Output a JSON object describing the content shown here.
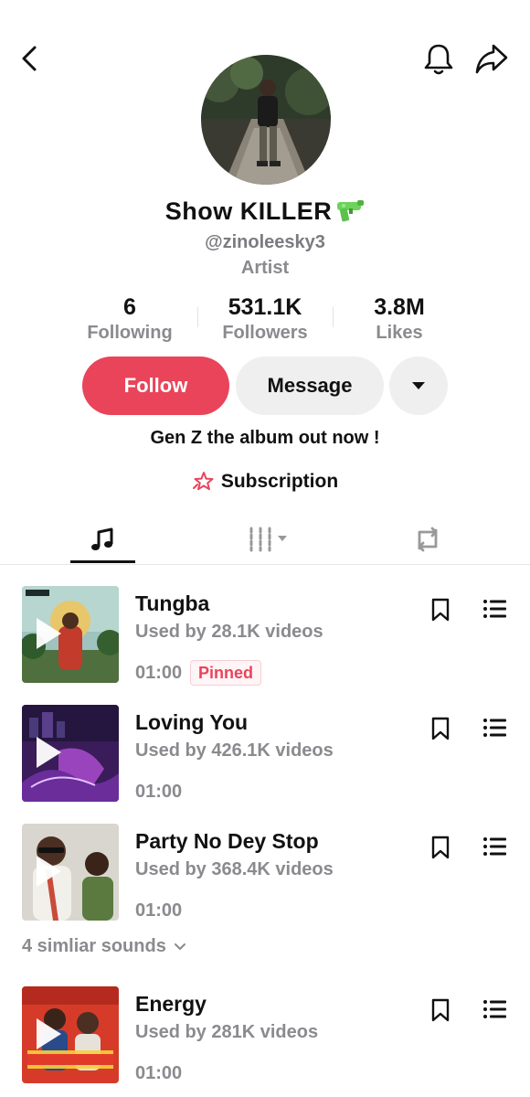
{
  "profile": {
    "name": "Show  KILLER",
    "handle": "@zinoleesky3",
    "role": "Artist",
    "bio": "Gen Z the album out now !",
    "subscription_label": "Subscription"
  },
  "stats": [
    {
      "value": "6",
      "label": "Following"
    },
    {
      "value": "531.1K",
      "label": "Followers"
    },
    {
      "value": "3.8M",
      "label": "Likes"
    }
  ],
  "actions": {
    "follow_label": "Follow",
    "message_label": "Message"
  },
  "tabs": [
    {
      "icon": "music-note-icon",
      "active": true
    },
    {
      "icon": "bars-filter-icon",
      "active": false
    },
    {
      "icon": "repost-icon",
      "active": false
    }
  ],
  "tracks": [
    {
      "title": "Tungba",
      "used_by": "Used by 28.1K videos",
      "duration": "01:00",
      "badge": "Pinned"
    },
    {
      "title": "Loving You",
      "used_by": "Used by 426.1K videos",
      "duration": "01:00"
    },
    {
      "title": "Party No Dey Stop",
      "used_by": "Used by 368.4K videos",
      "duration": "01:00"
    },
    {
      "title": "Energy",
      "used_by": "Used by 281K videos",
      "duration": "01:00"
    }
  ],
  "similar_sounds": "4 simliar sounds",
  "colors": {
    "accent": "#e9445a",
    "secondary_text": "#8a8a8f",
    "button_gray": "#efeff0"
  }
}
